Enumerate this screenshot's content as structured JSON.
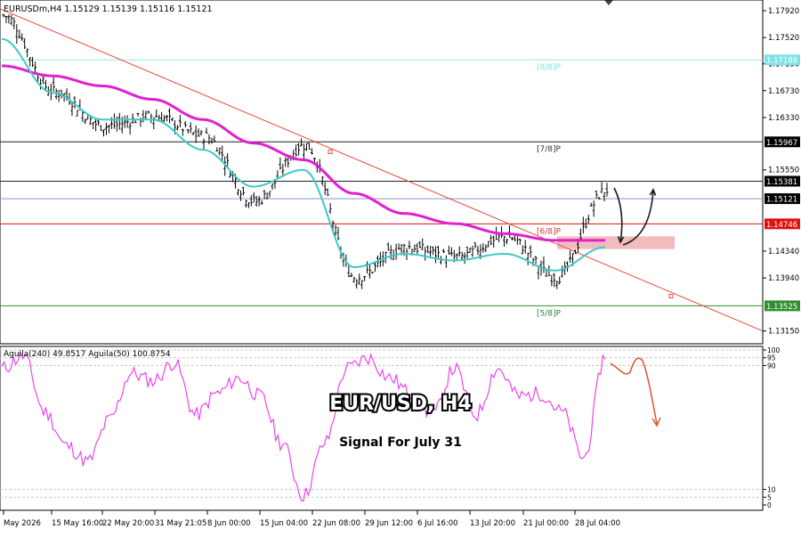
{
  "header": {
    "symbol_line": "EURUSDm,H4  1.15129 1.15139 1.15116 1.15121"
  },
  "main_panel": {
    "price_ticks": [
      "1.17920",
      "1.17520",
      "1.17130",
      "1.16730",
      "1.16330",
      "1.15550",
      "1.14340",
      "1.13940",
      "1.13150"
    ],
    "level_labels": [
      {
        "text": "[8/8]P",
        "color": "#7fe3e3"
      },
      {
        "text": "[7/8]P",
        "color": "#333333"
      },
      {
        "text": "[6/8]P",
        "color": "#e03030"
      },
      {
        "text": "[5/8]P",
        "color": "#2f7d2f"
      }
    ],
    "price_boxes": [
      {
        "text": "1.17188",
        "bg": "#7fe3e3",
        "fg": "#ffffff"
      },
      {
        "text": "1.15967",
        "bg": "#000000",
        "fg": "#ffffff"
      },
      {
        "text": "1.15381",
        "bg": "#000000",
        "fg": "#ffffff"
      },
      {
        "text": "1.15121",
        "bg": "#000000",
        "fg": "#ffffff"
      },
      {
        "text": "1.14746",
        "bg": "#e01010",
        "fg": "#ffffff"
      },
      {
        "text": "1.13525",
        "bg": "#2f8f2f",
        "fg": "#ffffff"
      }
    ]
  },
  "indicator_panel": {
    "label": "Aguila(240) 49.8517  Aguila(50) 100.8754",
    "ticks": [
      "100",
      "95",
      "90",
      "10",
      "5",
      "0"
    ],
    "title": "EUR/USD, H4",
    "subtitle": "Signal For July 31"
  },
  "x_axis": {
    "ticks": [
      "May 2026",
      "15 May 16:00",
      "22 May 20:00",
      "31 May 21:05",
      "8 Jun 00:00",
      "15 Jun 04:00",
      "22 Jun 08:00",
      "29 Jun 12:00",
      "6 Jul 16:00",
      "13 Jul 20:00",
      "21 Jul 00:00",
      "28 Jul 04:00"
    ]
  },
  "colors": {
    "price_line": "#000000",
    "fast_ma": "#40c8c8",
    "slow_ma": "#e020d0",
    "trendline": "#e84c3c",
    "oscillator": "#ee44ee",
    "zone": "#f2b8b8"
  },
  "chart_data": {
    "type": "line",
    "title": "EUR/USD, H4",
    "subtitle": "Signal For July 31",
    "symbol": "EURUSDm",
    "timeframe": "H4",
    "ohlc_current": {
      "open": 1.15129,
      "high": 1.15139,
      "low": 1.15116,
      "close": 1.15121
    },
    "x": [
      "May 2026",
      "15 May 16:00",
      "22 May 20:00",
      "31 May 21:05",
      "8 Jun 00:00",
      "15 Jun 04:00",
      "22 Jun 08:00",
      "29 Jun 12:00",
      "6 Jul 16:00",
      "13 Jul 20:00",
      "21 Jul 00:00",
      "28 Jul 04:00",
      "28 Jul 04:00+"
    ],
    "series": [
      {
        "values": [
          1.1785,
          1.1672,
          1.162,
          1.1635,
          1.1605,
          1.1508,
          1.1592,
          1.1395,
          1.144,
          1.1425,
          1.1455,
          1.1395,
          1.1525
        ]
      },
      {
        "values": [
          1.175,
          1.167,
          1.163,
          1.163,
          1.1585,
          1.153,
          1.1555,
          1.141,
          1.143,
          1.142,
          1.143,
          1.1405,
          1.144
        ]
      },
      {
        "values": [
          1.171,
          1.1695,
          1.168,
          1.166,
          1.163,
          1.1595,
          1.157,
          1.152,
          1.149,
          1.1475,
          1.146,
          1.145,
          1.145
        ]
      }
    ],
    "levels": [
      {
        "label": "[8/8]P",
        "value": 1.17188
      },
      {
        "label": "[7/8]P",
        "value": 1.15967
      },
      {
        "label": "",
        "value": 1.15381
      },
      {
        "label": "",
        "value": 1.15121
      },
      {
        "label": "[6/8]P",
        "value": 1.14746
      },
      {
        "label": "[5/8]P",
        "value": 1.13525
      }
    ],
    "y_ticks": [
      1.1792,
      1.1752,
      1.1713,
      1.1673,
      1.1633,
      1.1555,
      1.1434,
      1.1394,
      1.1315
    ],
    "ylim": [
      1.1296,
      1.1808
    ],
    "indicator": {
      "name": "Aguila",
      "values": {
        "Aguila(240)": 49.8517,
        "Aguila(50)": 100.8754
      },
      "ylim": [
        0,
        100
      ],
      "ticks": [
        100,
        95,
        90,
        10,
        5,
        0
      ],
      "series": [
        88,
        96,
        60,
        38,
        28,
        55,
        85,
        80,
        92,
        58,
        72,
        82,
        70,
        40,
        6,
        40,
        88,
        95,
        82,
        72,
        58,
        88,
        58,
        88,
        70,
        72,
        60,
        30,
        96
      ]
    },
    "grid": false,
    "legend": "none"
  }
}
